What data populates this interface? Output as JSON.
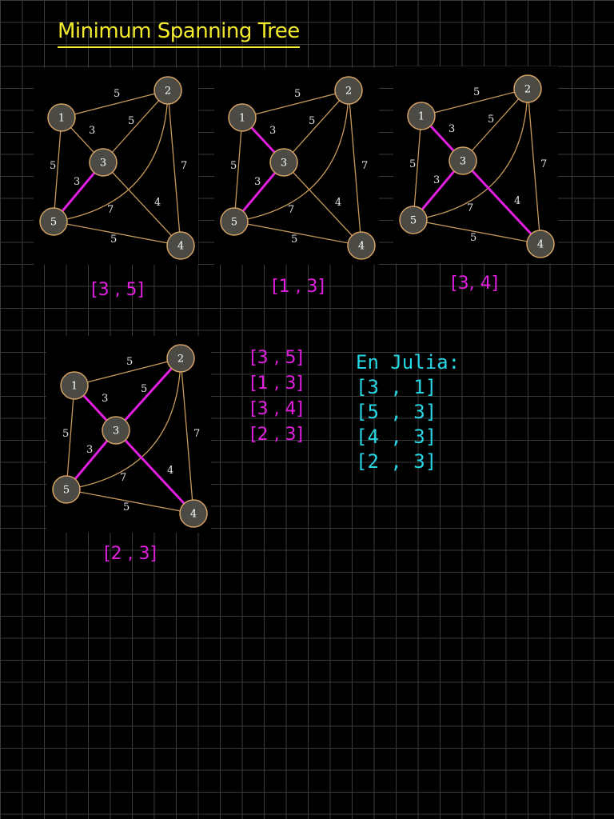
{
  "title": "Minimum Spanning Tree",
  "graph": {
    "nodes": [
      "1",
      "2",
      "3",
      "4",
      "5"
    ],
    "edges": [
      {
        "a": "1",
        "b": "2",
        "w": "5"
      },
      {
        "a": "1",
        "b": "3",
        "w": "3"
      },
      {
        "a": "1",
        "b": "5",
        "w": "5"
      },
      {
        "a": "2",
        "b": "3",
        "w": "5"
      },
      {
        "a": "2",
        "b": "4",
        "w": "7"
      },
      {
        "a": "2",
        "b": "5",
        "w": "7"
      },
      {
        "a": "3",
        "b": "4",
        "w": "4"
      },
      {
        "a": "3",
        "b": "5",
        "w": "3"
      },
      {
        "a": "4",
        "b": "5",
        "w": "5"
      }
    ]
  },
  "steps": [
    {
      "caption": "[3 , 5]",
      "mst": [
        "3-5"
      ]
    },
    {
      "caption": "[1 , 3]",
      "mst": [
        "3-5",
        "1-3"
      ]
    },
    {
      "caption": "[3, 4]",
      "mst": [
        "3-5",
        "1-3",
        "3-4"
      ]
    },
    {
      "caption": "[2 , 3]",
      "mst": [
        "3-5",
        "1-3",
        "3-4",
        "2-3"
      ]
    }
  ],
  "edge_list": [
    "[3 , 5]",
    "[1 , 3]",
    "[3 , 4]",
    "[2 , 3]"
  ],
  "julia": {
    "heading": "En Julia:",
    "lines": [
      "[3 , 1]",
      "[5 , 3]",
      "[4 , 3]",
      "[2 , 3]"
    ]
  },
  "colors": {
    "background": "#000000",
    "grid": "#3a3a3a",
    "title": "#f2ea2c",
    "mst_edge": "#e21ee0",
    "edge": "#c6995a",
    "node_fill": "#4c4a44",
    "node_stroke": "#d5a265",
    "julia_text": "#27d6e4"
  }
}
